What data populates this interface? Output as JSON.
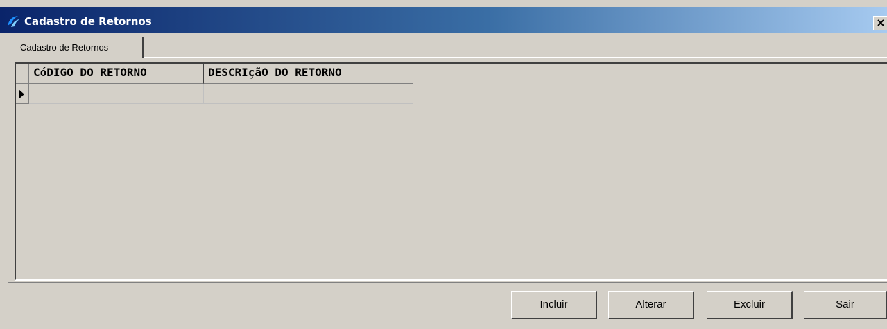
{
  "window": {
    "title": "Cadastro de Retornos",
    "icon": "app-logo-icon",
    "close_icon": "close-icon"
  },
  "tabs": [
    {
      "label": "Cadastro de Retornos"
    }
  ],
  "grid": {
    "columns": [
      {
        "header": "CóDIGO DO RETORNO"
      },
      {
        "header": "DESCRIçãO DO RETORNO"
      }
    ],
    "rows": [
      {
        "cells": [
          "",
          ""
        ],
        "current": true
      }
    ],
    "row_indicator_icon": "current-row-arrow-icon"
  },
  "buttons": {
    "incluir": "Incluir",
    "alterar": "Alterar",
    "excluir": "Excluir",
    "sair": "Sair"
  }
}
